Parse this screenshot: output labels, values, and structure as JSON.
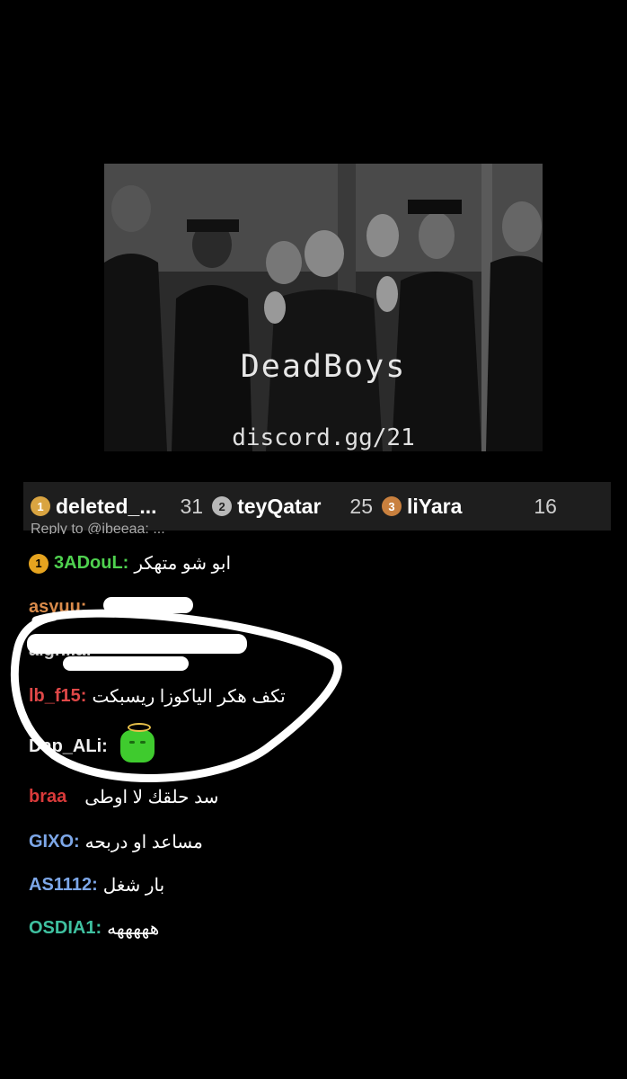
{
  "stream": {
    "image_title": "DeadBoys",
    "image_subtitle": "discord.gg/21"
  },
  "leaderboard": [
    {
      "rank": "1",
      "name": "deleted_...",
      "count": "31",
      "badge_color": "#d9a441"
    },
    {
      "rank": "2",
      "name": "teyQatar",
      "count": "25",
      "badge_color": "#b8b8b8"
    },
    {
      "rank": "3",
      "name": "liYara",
      "count": "16",
      "badge_color": "#c9803e"
    }
  ],
  "chat": {
    "reply_hint": "Reply to @ibeeaa: ...",
    "messages": [
      {
        "badge": "1",
        "user": "3ADouL:",
        "text": "ابو شو متهكر",
        "color": "#4fd14f"
      },
      {
        "user": "asyuu:",
        "text": "",
        "color": "#d98a4a"
      },
      {
        "user": "alghila:",
        "text": "",
        "color": "#cfcfcf"
      },
      {
        "user": "lb_f15:",
        "text": "تكف هكر الياكوزا ريسبكت",
        "color": "#e04848"
      },
      {
        "user": "Dap_ALi:",
        "text": "",
        "color": "#f0f0f0"
      },
      {
        "user": "braa",
        "text": "سد حلقك لا اوطى",
        "color": "#d93a3a"
      },
      {
        "user": "GIXO:",
        "text": "مساعد او دربحه",
        "color": "#7da7e8"
      },
      {
        "user": "AS1112:",
        "text": "بار شغل",
        "color": "#7da7e8"
      },
      {
        "user": "OSDIA1:",
        "text": "هههههه",
        "color": "#3fc1a0"
      }
    ]
  },
  "colors": {
    "annotation": "#ffffff",
    "emote": "#3fcb2e"
  }
}
